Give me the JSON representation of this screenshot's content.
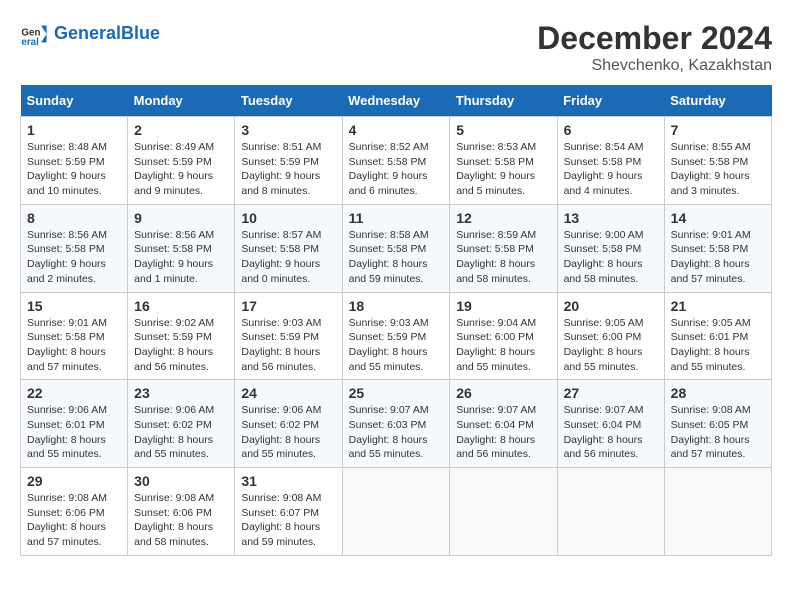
{
  "logo": {
    "text_general": "General",
    "text_blue": "Blue"
  },
  "header": {
    "title": "December 2024",
    "subtitle": "Shevchenko, Kazakhstan"
  },
  "weekdays": [
    "Sunday",
    "Monday",
    "Tuesday",
    "Wednesday",
    "Thursday",
    "Friday",
    "Saturday"
  ],
  "weeks": [
    [
      {
        "day": "1",
        "sunrise": "8:48 AM",
        "sunset": "5:59 PM",
        "daylight": "9 hours and 10 minutes."
      },
      {
        "day": "2",
        "sunrise": "8:49 AM",
        "sunset": "5:59 PM",
        "daylight": "9 hours and 9 minutes."
      },
      {
        "day": "3",
        "sunrise": "8:51 AM",
        "sunset": "5:59 PM",
        "daylight": "9 hours and 8 minutes."
      },
      {
        "day": "4",
        "sunrise": "8:52 AM",
        "sunset": "5:58 PM",
        "daylight": "9 hours and 6 minutes."
      },
      {
        "day": "5",
        "sunrise": "8:53 AM",
        "sunset": "5:58 PM",
        "daylight": "9 hours and 5 minutes."
      },
      {
        "day": "6",
        "sunrise": "8:54 AM",
        "sunset": "5:58 PM",
        "daylight": "9 hours and 4 minutes."
      },
      {
        "day": "7",
        "sunrise": "8:55 AM",
        "sunset": "5:58 PM",
        "daylight": "9 hours and 3 minutes."
      }
    ],
    [
      {
        "day": "8",
        "sunrise": "8:56 AM",
        "sunset": "5:58 PM",
        "daylight": "9 hours and 2 minutes."
      },
      {
        "day": "9",
        "sunrise": "8:56 AM",
        "sunset": "5:58 PM",
        "daylight": "9 hours and 1 minute."
      },
      {
        "day": "10",
        "sunrise": "8:57 AM",
        "sunset": "5:58 PM",
        "daylight": "9 hours and 0 minutes."
      },
      {
        "day": "11",
        "sunrise": "8:58 AM",
        "sunset": "5:58 PM",
        "daylight": "8 hours and 59 minutes."
      },
      {
        "day": "12",
        "sunrise": "8:59 AM",
        "sunset": "5:58 PM",
        "daylight": "8 hours and 58 minutes."
      },
      {
        "day": "13",
        "sunrise": "9:00 AM",
        "sunset": "5:58 PM",
        "daylight": "8 hours and 58 minutes."
      },
      {
        "day": "14",
        "sunrise": "9:01 AM",
        "sunset": "5:58 PM",
        "daylight": "8 hours and 57 minutes."
      }
    ],
    [
      {
        "day": "15",
        "sunrise": "9:01 AM",
        "sunset": "5:58 PM",
        "daylight": "8 hours and 57 minutes."
      },
      {
        "day": "16",
        "sunrise": "9:02 AM",
        "sunset": "5:59 PM",
        "daylight": "8 hours and 56 minutes."
      },
      {
        "day": "17",
        "sunrise": "9:03 AM",
        "sunset": "5:59 PM",
        "daylight": "8 hours and 56 minutes."
      },
      {
        "day": "18",
        "sunrise": "9:03 AM",
        "sunset": "5:59 PM",
        "daylight": "8 hours and 55 minutes."
      },
      {
        "day": "19",
        "sunrise": "9:04 AM",
        "sunset": "6:00 PM",
        "daylight": "8 hours and 55 minutes."
      },
      {
        "day": "20",
        "sunrise": "9:05 AM",
        "sunset": "6:00 PM",
        "daylight": "8 hours and 55 minutes."
      },
      {
        "day": "21",
        "sunrise": "9:05 AM",
        "sunset": "6:01 PM",
        "daylight": "8 hours and 55 minutes."
      }
    ],
    [
      {
        "day": "22",
        "sunrise": "9:06 AM",
        "sunset": "6:01 PM",
        "daylight": "8 hours and 55 minutes."
      },
      {
        "day": "23",
        "sunrise": "9:06 AM",
        "sunset": "6:02 PM",
        "daylight": "8 hours and 55 minutes."
      },
      {
        "day": "24",
        "sunrise": "9:06 AM",
        "sunset": "6:02 PM",
        "daylight": "8 hours and 55 minutes."
      },
      {
        "day": "25",
        "sunrise": "9:07 AM",
        "sunset": "6:03 PM",
        "daylight": "8 hours and 55 minutes."
      },
      {
        "day": "26",
        "sunrise": "9:07 AM",
        "sunset": "6:04 PM",
        "daylight": "8 hours and 56 minutes."
      },
      {
        "day": "27",
        "sunrise": "9:07 AM",
        "sunset": "6:04 PM",
        "daylight": "8 hours and 56 minutes."
      },
      {
        "day": "28",
        "sunrise": "9:08 AM",
        "sunset": "6:05 PM",
        "daylight": "8 hours and 57 minutes."
      }
    ],
    [
      {
        "day": "29",
        "sunrise": "9:08 AM",
        "sunset": "6:06 PM",
        "daylight": "8 hours and 57 minutes."
      },
      {
        "day": "30",
        "sunrise": "9:08 AM",
        "sunset": "6:06 PM",
        "daylight": "8 hours and 58 minutes."
      },
      {
        "day": "31",
        "sunrise": "9:08 AM",
        "sunset": "6:07 PM",
        "daylight": "8 hours and 59 minutes."
      },
      null,
      null,
      null,
      null
    ]
  ],
  "labels": {
    "sunrise": "Sunrise:",
    "sunset": "Sunset:",
    "daylight": "Daylight:"
  }
}
